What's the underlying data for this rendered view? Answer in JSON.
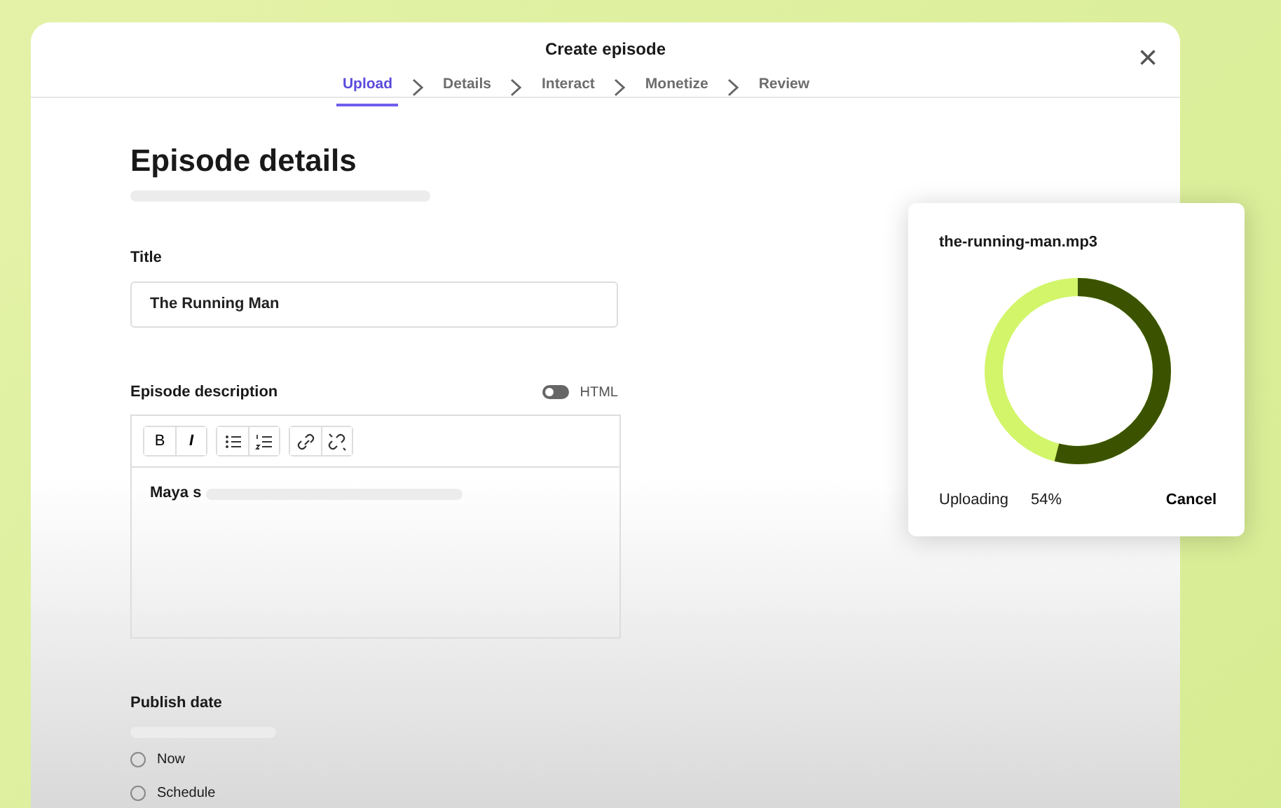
{
  "window": {
    "title": "Create episode",
    "close": "×"
  },
  "steps": [
    {
      "label": "Upload",
      "selected": true
    },
    {
      "label": "Details",
      "selected": false
    },
    {
      "label": "Interact",
      "selected": false
    },
    {
      "label": "Monetize",
      "selected": false
    },
    {
      "label": "Review",
      "selected": false
    }
  ],
  "heading": "Episode details",
  "title_field": {
    "label": "Title",
    "value": "The Running Man"
  },
  "description": {
    "label": "Episode description",
    "html_toggle": {
      "label": "HTML",
      "on": false
    },
    "toolbar": [
      {
        "kind": "bold",
        "text": "B"
      },
      {
        "kind": "italic",
        "text": "I"
      },
      {
        "kind": "bullets"
      },
      {
        "kind": "numbers"
      },
      {
        "kind": "link"
      },
      {
        "kind": "unlink"
      }
    ],
    "value": "Maya s"
  },
  "publish_date": {
    "label": "Publish date",
    "options": [
      {
        "label": "Now",
        "selected": false
      },
      {
        "label": "Schedule",
        "selected": false
      }
    ]
  },
  "upload": {
    "filename": "the-running-man.mp3",
    "level": 0.54,
    "status": "Uploading",
    "percent": "54%",
    "cancel": "Cancel"
  }
}
